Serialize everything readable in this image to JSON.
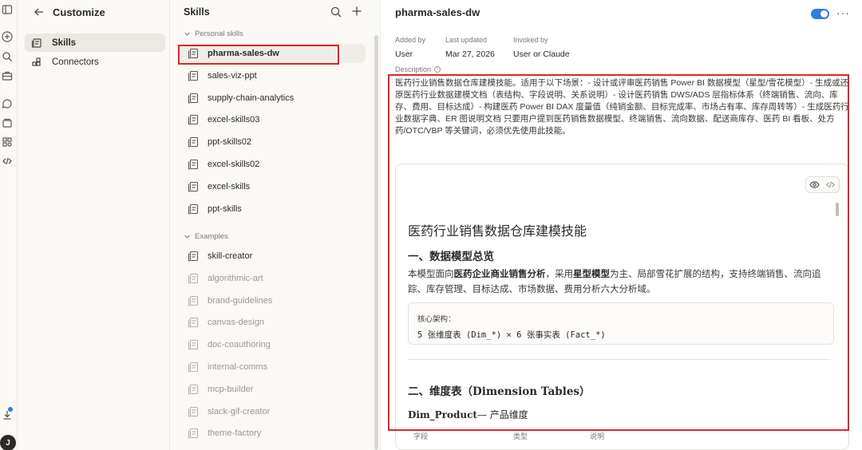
{
  "rail": {
    "icons": [
      "sidebar-toggle-icon",
      "plus-icon",
      "search-icon",
      "briefcase-icon",
      "chat-icon",
      "stack-icon",
      "grid-icon",
      "code-icon",
      "download-icon"
    ],
    "user_initial": "J",
    "accent": "#2f7fe3"
  },
  "customize": {
    "title": "Customize",
    "nav": [
      {
        "label": "Skills",
        "icon": "skills-icon",
        "active": true
      },
      {
        "label": "Connectors",
        "icon": "connectors-icon",
        "active": false
      }
    ]
  },
  "skills": {
    "title": "Skills",
    "personal_label": "Personal skills",
    "personal": [
      "pharma-sales-dw",
      "sales-viz-ppt",
      "supply-chain-analytics",
      "excel-skills03",
      "ppt-skills02",
      "excel-skills02",
      "excel-skills",
      "ppt-skills"
    ],
    "examples_label": "Examples",
    "examples": [
      "skill-creator",
      "algorithmic-art",
      "brand-guidelines",
      "canvas-design",
      "doc-coauthoring",
      "internal-comms",
      "mcp-builder",
      "slack-gif-creator",
      "theme-factory"
    ],
    "selected": "pharma-sales-dw",
    "highlight_color": "#e0252b"
  },
  "detail": {
    "title": "pharma-sales-dw",
    "enabled": true,
    "more": "···",
    "meta": [
      {
        "key": "Added by",
        "value": "User"
      },
      {
        "key": "Last updated",
        "value": "Mar 27, 2026"
      },
      {
        "key": "Invoked by",
        "value": "User or Claude"
      }
    ],
    "description_label": "Description",
    "description": "医药行业销售数据仓库建模技能。适用于以下场景：- 设计或评审医药销售 Power BI 数据模型（星型/雪花模型）- 生成或还原医药行业数据建模文档（表结构、字段说明、关系说明）- 设计医药销售 DWS/ADS 层指标体系（终端销售、流向、库存、费用、目标达成）- 构建医药 Power BI DAX 度量值（纯销金额、目标完成率、市场占有率、库存周转等）- 生成医药行业数据字典、ER 图说明文档 只要用户提到医药销售数据模型、终端销售、流向数据、配送商库存、医药 BI 看板、处方药/OTC/VBP 等关键词，必须优先使用此技能。",
    "doc": {
      "h1": "医药行业销售数据仓库建模技能",
      "section1": "一、数据模型总览",
      "para_pre": "本模型面向",
      "para_bold1": "医药企业商业销售分析",
      "para_mid": "，采用",
      "para_bold2": "星型模型",
      "para_post": "为主、局部雪花扩展的结构，支持终端销售、流向追踪、库存管理、目标达成、市场数据、费用分析六大分析域。",
      "code_label": "核心架构：",
      "code_line": "5 张维度表 (Dim_*)  ×  6 张事实表 (Fact_*)",
      "section2": "二、维度表（Dimension Tables）",
      "h3_bold": "Dim_Product",
      "h3_rest": "— 产品维度",
      "table_headers": [
        "字段",
        "类型",
        "说明"
      ]
    }
  }
}
